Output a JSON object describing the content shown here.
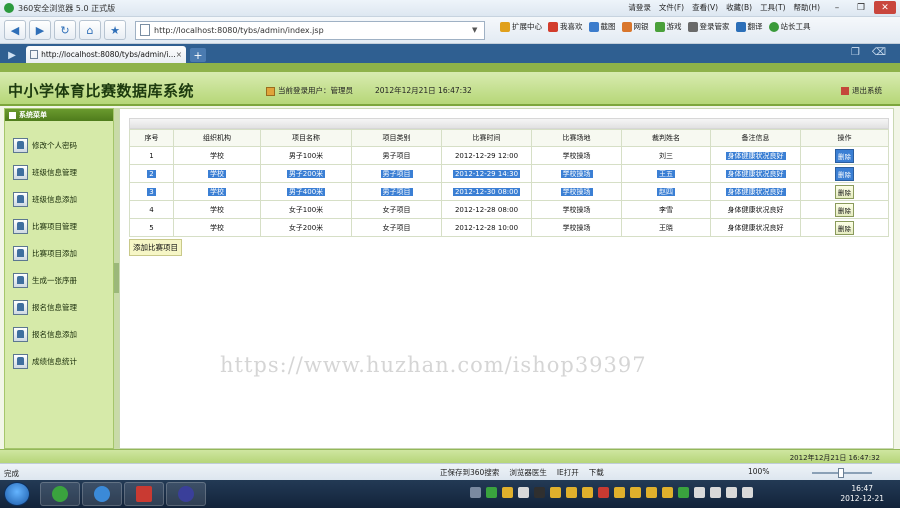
{
  "browser": {
    "title": "360安全浏览器 5.0 正式版",
    "menus": [
      "请登录",
      "文件(F)",
      "查看(V)",
      "收藏(B)",
      "工具(T)",
      "帮助(H)"
    ],
    "url": "http://localhost:8080/tybs/admin/index.jsp",
    "tools": [
      "扩展中心",
      "我喜欢",
      "截图",
      "网银",
      "游戏",
      "登录管家",
      "翻译",
      "站长工具"
    ],
    "tab_title": "http://localhost:8080/tybs/admin/i...",
    "status_left": "完成",
    "status_items": [
      "正保存到360搜索",
      "浏览器医生",
      "IE打开",
      "下载"
    ],
    "zoom": "100%"
  },
  "app": {
    "title": "中小学体育比赛数据库系统",
    "user_label": "当前登录用户：管理员",
    "datetime": "2012年12月21日  16:47:32",
    "logout": "退出系统",
    "sidebar_title": "系统菜单",
    "menu": [
      "修改个人密码",
      "班级信息管理",
      "班级信息添加",
      "比赛项目管理",
      "比赛项目添加",
      "生成一张序册",
      "报名信息管理",
      "报名信息添加",
      "成绩信息统计"
    ],
    "footer_datetime": "2012年12月21日  16:47:32",
    "add_button": "添加比赛项目"
  },
  "table": {
    "headers": [
      "序号",
      "组织机构",
      "项目名称",
      "项目类别",
      "比赛时间",
      "比赛场地",
      "裁判姓名",
      "备注信息",
      "操作"
    ],
    "rows": [
      [
        "1",
        "学校",
        "男子100米",
        "男子项目",
        "2012-12-29 12:00",
        "学校操场",
        "刘三",
        "身体健康状况良好",
        "删除"
      ],
      [
        "2",
        "学校",
        "男子200米",
        "男子项目",
        "2012-12-29 14:30",
        "学校操场",
        "王五",
        "身体健康状况良好",
        "删除"
      ],
      [
        "3",
        "学校",
        "男子400米",
        "男子项目",
        "2012-12-30 08:00",
        "学校操场",
        "赵四",
        "身体健康状况良好",
        "删除"
      ],
      [
        "4",
        "学校",
        "女子100米",
        "女子项目",
        "2012-12-28 08:00",
        "学校操场",
        "李雪",
        "身体健康状况良好",
        "删除"
      ],
      [
        "5",
        "学校",
        "女子200米",
        "女子项目",
        "2012-12-28 10:00",
        "学校操场",
        "王晓",
        "身体健康状况良好",
        "删除"
      ]
    ]
  },
  "watermark": "https://www.huzhan.com/ishop39397",
  "taskbar": {
    "clock_time": "16:47",
    "clock_date": "2012-12-21"
  }
}
